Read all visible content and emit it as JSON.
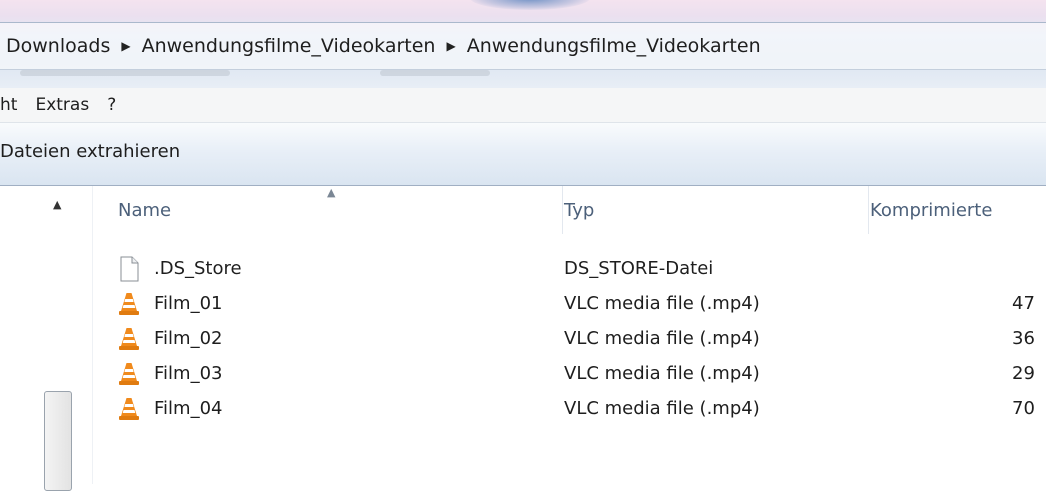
{
  "breadcrumb": [
    "Downloads",
    "Anwendungsfilme_Videokarten",
    "Anwendungsfilme_Videokarten"
  ],
  "menubar": {
    "items": [
      "ht",
      "Extras",
      "?"
    ]
  },
  "commandbar": {
    "extract_label": "Dateien extrahieren"
  },
  "columns": {
    "name": "Name",
    "type": "Typ",
    "size": "Komprimierte"
  },
  "files": [
    {
      "name": ".DS_Store",
      "type": "DS_STORE-Datei",
      "size": "",
      "icon": "blank-file-icon"
    },
    {
      "name": "Film_01",
      "type": "VLC media file (.mp4)",
      "size": "47",
      "icon": "vlc-cone-icon"
    },
    {
      "name": "Film_02",
      "type": "VLC media file (.mp4)",
      "size": "36",
      "icon": "vlc-cone-icon"
    },
    {
      "name": "Film_03",
      "type": "VLC media file (.mp4)",
      "size": "29",
      "icon": "vlc-cone-icon"
    },
    {
      "name": "Film_04",
      "type": "VLC media file (.mp4)",
      "size": "70",
      "icon": "vlc-cone-icon"
    }
  ],
  "colors": {
    "vlc_orange": "#f08a1c",
    "header_text": "#4c607a",
    "accent": "#dae5f1"
  }
}
